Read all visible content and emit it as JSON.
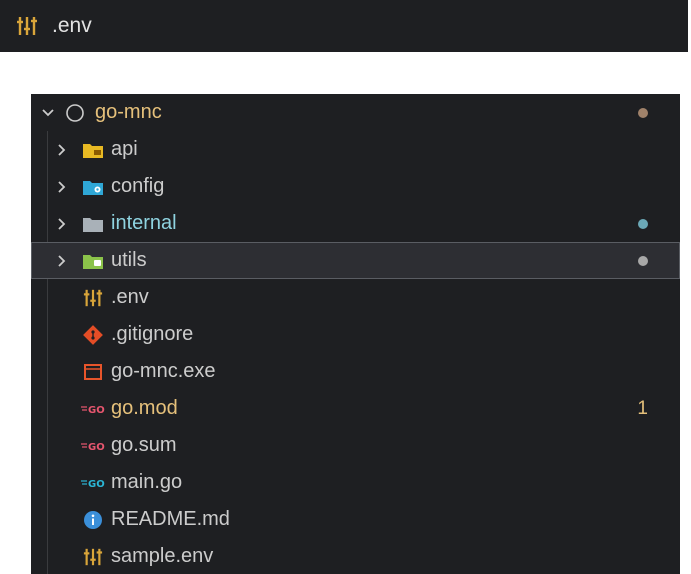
{
  "top_bar": {
    "filename": ".env",
    "icon": "sliders-icon"
  },
  "explorer": {
    "root": {
      "label": "go-mnc",
      "icon": "circle-outline-icon",
      "status_color": "#a0826a"
    },
    "items": [
      {
        "label": "api",
        "kind": "folder",
        "icon": "folder-api-icon",
        "status_color": ""
      },
      {
        "label": "config",
        "kind": "folder",
        "icon": "folder-config-icon",
        "status_color": ""
      },
      {
        "label": "internal",
        "kind": "folder",
        "icon": "folder-internal-icon",
        "status_color": "#6ba8b7"
      },
      {
        "label": "utils",
        "kind": "folder",
        "icon": "folder-utils-icon",
        "status_color": "#a8a8a8"
      },
      {
        "label": ".env",
        "kind": "file",
        "icon": "sliders-icon"
      },
      {
        "label": ".gitignore",
        "kind": "file",
        "icon": "git-icon"
      },
      {
        "label": "go-mnc.exe",
        "kind": "file",
        "icon": "window-icon"
      },
      {
        "label": "go.mod",
        "kind": "file",
        "icon": "go-mod-icon",
        "badge": "1"
      },
      {
        "label": "go.sum",
        "kind": "file",
        "icon": "go-sum-icon"
      },
      {
        "label": "main.go",
        "kind": "file",
        "icon": "go-file-icon"
      },
      {
        "label": "README.md",
        "kind": "file",
        "icon": "info-icon"
      },
      {
        "label": "sample.env",
        "kind": "file",
        "icon": "sliders-icon"
      }
    ]
  },
  "colors": {
    "panel_bg": "#1e1f22",
    "text": "#cccccc",
    "root_text": "#e5c07b",
    "internal_text": "#8fd3e0",
    "modified_text": "#e5c07b",
    "go_pink": "#e8566f",
    "go_cyan": "#2bb6d6",
    "api_folder": "#e8b923",
    "config_folder": "#2fa7d6",
    "utils_folder": "#8bc34a",
    "git_red": "#e44d26",
    "exe_orange": "#e8552b",
    "info_blue": "#3b8fd9",
    "env_yellow": "#d9a53a"
  }
}
